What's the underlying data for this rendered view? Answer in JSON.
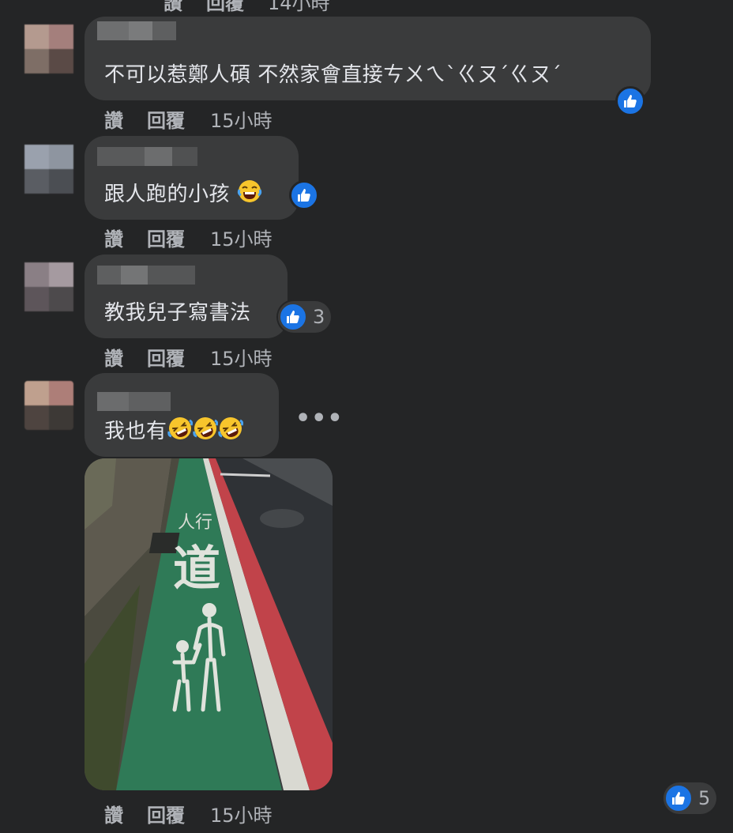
{
  "top_partial_actions": {
    "like": "讚",
    "reply": "回覆",
    "time": "14小時"
  },
  "comments": [
    {
      "text": "不可以惹鄭人碩 不然家會直接ㄘㄨㄟˋㄍㄡˊㄍㄡˊ",
      "actions": {
        "like": "讚",
        "reply": "回覆",
        "time": "15小時"
      },
      "avatar_colors": [
        "#b49a8f",
        "#a47f7c",
        "#7e6e66",
        "#5a4a46"
      ]
    },
    {
      "text": "跟人跑的小孩",
      "emoji": "tears-of-joy",
      "actions": {
        "like": "讚",
        "reply": "回覆",
        "time": "15小時"
      },
      "avatar_colors": [
        "#9aa1ad",
        "#8e95a0",
        "#5a5d63",
        "#4b4e53"
      ]
    },
    {
      "text": "教我兒子寫書法",
      "reaction_count": "3",
      "actions": {
        "like": "讚",
        "reply": "回覆",
        "time": "15小時"
      },
      "avatar_colors": [
        "#8a7f85",
        "#a59aa0",
        "#5d555a",
        "#4d4a4c"
      ]
    },
    {
      "text": "我也有",
      "emoji": "rolling-on-floor-laughing",
      "reaction_count": "5",
      "actions": {
        "like": "讚",
        "reply": "回覆",
        "time": "15小時"
      },
      "avatar_colors": [
        "#bfa08e",
        "#ad7e78",
        "#4e4440",
        "#3d3936"
      ]
    }
  ],
  "more_label": "•••",
  "photo": {
    "painted_text_1": "人行",
    "painted_text_2": "道"
  },
  "colors": {
    "background": "#242526",
    "bubble": "#3a3b3c",
    "like_blue": "#1b74e4",
    "secondary_text": "#b0b3b8"
  }
}
